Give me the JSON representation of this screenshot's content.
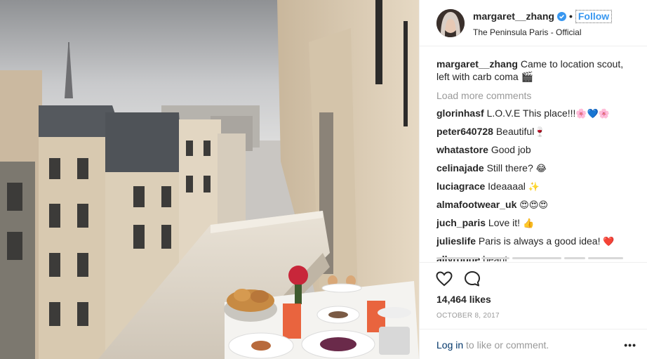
{
  "post": {
    "username": "margaret__zhang",
    "separator": "•",
    "follow_label": "Follow",
    "location": "The Peninsula Paris - Official",
    "caption_user": "margaret__zhang",
    "caption_text": "Came to location scout, left with carb coma 🎬",
    "load_more": "Load more comments",
    "comments": [
      {
        "user": "glorinhasf",
        "text": "L.O.V.E This place!!!",
        "emoji": "🌸💙🌸"
      },
      {
        "user": "peter640728",
        "text": "Beautiful",
        "emoji": "🍷"
      },
      {
        "user": "whatastore",
        "text": "Good job",
        "emoji": ""
      },
      {
        "user": "celinajade",
        "text": "Still there?",
        "emoji": "😂"
      },
      {
        "user": "luciagrace",
        "text": "Ideaaaal",
        "emoji": "✨"
      },
      {
        "user": "almafootwear_uk",
        "text": "",
        "emoji": "😍😍😍"
      },
      {
        "user": "juch_paris",
        "text": "Love it!",
        "emoji": "👍"
      },
      {
        "user": "julieslife",
        "text": "Paris is always a good idea!",
        "emoji": "❤️"
      },
      {
        "user": "allyrouge",
        "text": "beaut",
        "emoji": ""
      }
    ],
    "likes": "14,464 likes",
    "date": "OCTOBER 8, 2017",
    "login_link": "Log in",
    "login_suffix": " to like or comment.",
    "more_label": "•••"
  },
  "icons": {
    "verified": "verified-badge-icon",
    "like": "heart-icon",
    "comment": "comment-bubble-icon",
    "more": "more-options-icon"
  },
  "colors": {
    "link_blue": "#3897f0",
    "text": "#262626",
    "muted": "#999999",
    "login": "#003569"
  }
}
